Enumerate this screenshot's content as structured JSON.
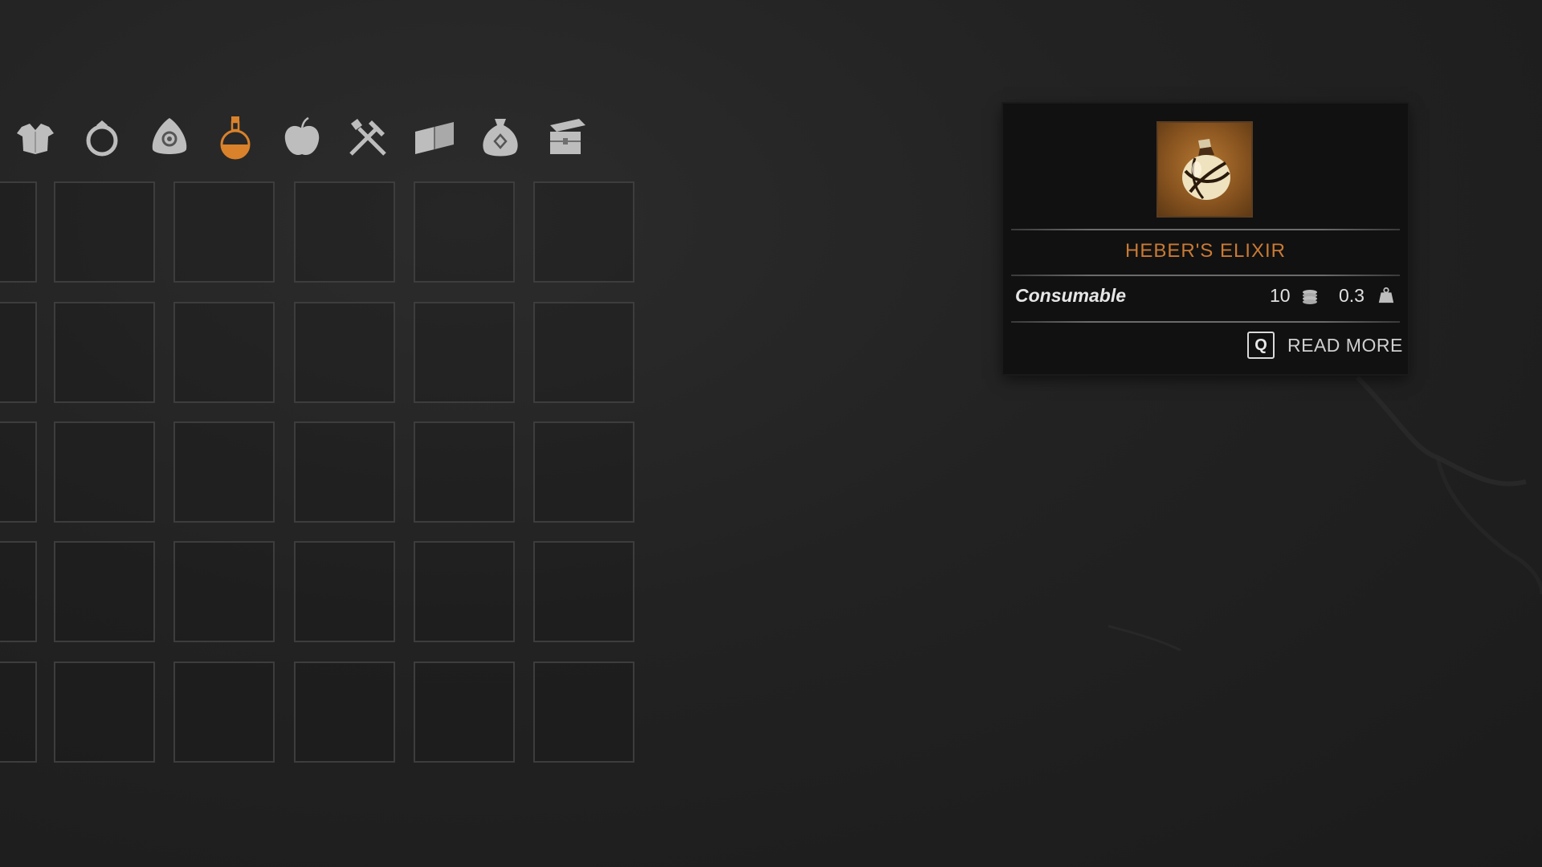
{
  "categories": [
    {
      "icon": "armor-icon",
      "active": false
    },
    {
      "icon": "ring-icon",
      "active": false
    },
    {
      "icon": "amulet-icon",
      "active": false
    },
    {
      "icon": "potion-icon",
      "active": true
    },
    {
      "icon": "apple-icon",
      "active": false
    },
    {
      "icon": "tools-icon",
      "active": false
    },
    {
      "icon": "book-icon",
      "active": false
    },
    {
      "icon": "money-bag-icon",
      "active": false
    },
    {
      "icon": "chest-icon",
      "active": false
    }
  ],
  "colors": {
    "accent": "#c97a35",
    "icon_inactive": "#bdbdbd",
    "slot_border": "#3d3d3d"
  },
  "inventory": {
    "rows": 5,
    "columns": 6,
    "partial_left_column": true
  },
  "tooltip": {
    "item_icon": "elixir-bottle-icon",
    "item_name": "HEBER'S ELIXIR",
    "item_type": "Consumable",
    "value": "10",
    "value_icon": "coins-icon",
    "weight": "0.3",
    "weight_icon": "weight-icon",
    "read_more_key": "Q",
    "read_more_label": "READ MORE"
  }
}
